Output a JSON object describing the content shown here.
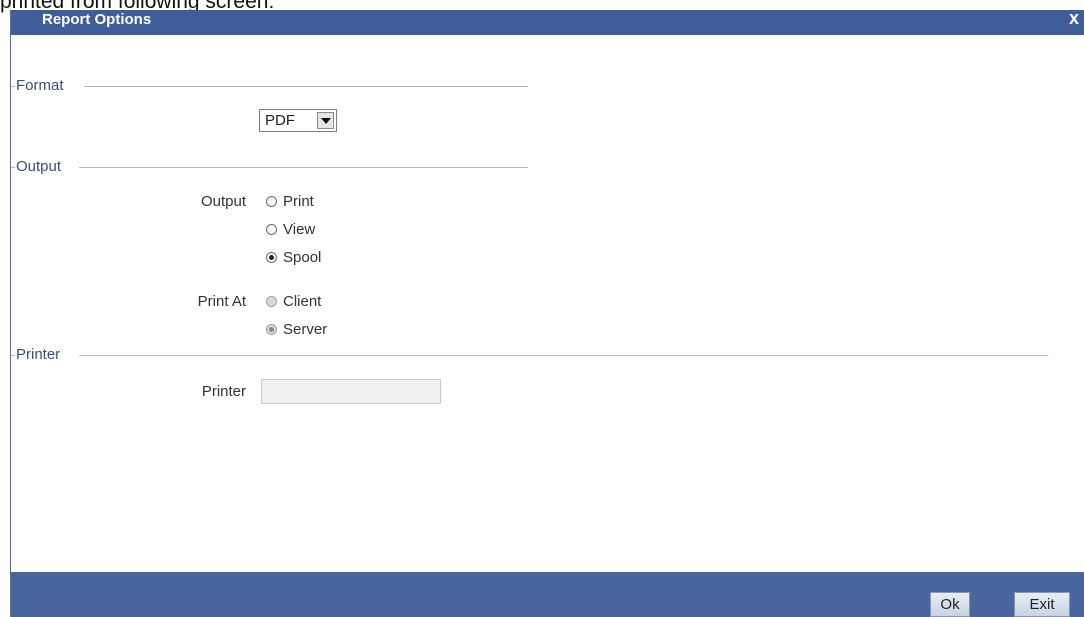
{
  "document_text": "printed from following screen:",
  "window": {
    "title": "Report Options",
    "close_glyph": "x"
  },
  "sections": {
    "format": "Format",
    "output": "Output",
    "printer": "Printer"
  },
  "format": {
    "selected": "PDF"
  },
  "output": {
    "label": "Output",
    "options": [
      "Print",
      "View",
      "Spool"
    ],
    "selected": "Spool"
  },
  "print_at": {
    "label": "Print At",
    "options": [
      "Client",
      "Server"
    ],
    "selected": "Server",
    "disabled": true
  },
  "printer": {
    "label": "Printer",
    "value": ""
  },
  "buttons": {
    "ok": "Ok",
    "exit": "Exit"
  },
  "colors": {
    "titlebar": "#3e5d99",
    "footer": "#49659e",
    "section_label": "#3b4f78",
    "section_line": "#a9bcd6"
  }
}
